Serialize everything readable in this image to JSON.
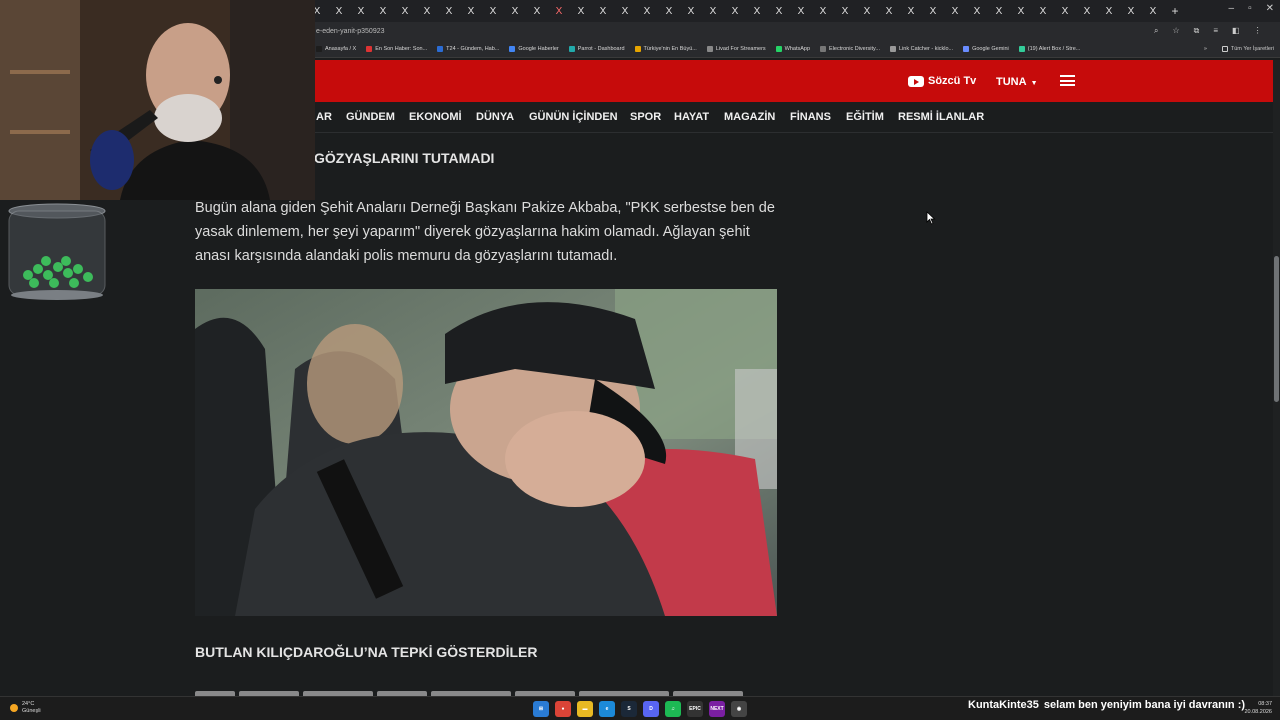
{
  "browser": {
    "tab_close_glyph": "X",
    "new_tab_glyph": "+",
    "window_controls": [
      "–",
      "▫",
      "✕"
    ],
    "url": "e-eden-yanit-p350923",
    "address_icons": [
      "⌕",
      "☆",
      "⧉",
      "≡",
      "◧",
      "⋮"
    ],
    "bookmarks": [
      {
        "label": "Anasayfa / X",
        "color": "#1d1d1d"
      },
      {
        "label": "En Son Haber: Son...",
        "color": "#d33"
      },
      {
        "label": "T24 - Gündem, Hab...",
        "color": "#2b6cd4"
      },
      {
        "label": "Google Haberler",
        "color": "#4285f4"
      },
      {
        "label": "Parrot - Dashboard",
        "color": "#2aa"
      },
      {
        "label": "Türkiye'nin En Büyü...",
        "color": "#e6a400"
      },
      {
        "label": "Livad For Streamers",
        "color": "#888"
      },
      {
        "label": "WhatsApp",
        "color": "#25d366"
      },
      {
        "label": "Electronic Diversity...",
        "color": "#777"
      },
      {
        "label": "Link Catcher - kicklo...",
        "color": "#999"
      },
      {
        "label": "Google Gemini",
        "color": "#6a8cff"
      },
      {
        "label": "(19) Alert Box / Stre...",
        "color": "#3c9"
      }
    ],
    "bookmarks_more": "»",
    "all_bookmarks": "Tüm Yer İşaretleri"
  },
  "site": {
    "youtube_label": "Sözcü Tv",
    "user_label": "TUNA",
    "nav": [
      "AR",
      "GÜNDEM",
      "EKONOMİ",
      "DÜNYA",
      "GÜNÜN İÇİNDEN",
      "SPOR",
      "HAYAT",
      "MAGAZİN",
      "FİNANS",
      "EĞİTİM",
      "RESMİ İLANLAR"
    ]
  },
  "article": {
    "subheading": "GÖZYAŞLARINI TUTAMADI",
    "paragraph": "Bugün alana giden Şehit Analarıı Derneği Başkanı Pakize Akbaba, \"PKK serbestse ben de yasak dinlemem, her şeyi yaparım\" diyerek gözyaşlarına hakim olamadı. Ağlayan şehit anası karşısında alandaki polis memuru da gözyaşlarını tutamadı.",
    "subheading2": "BUTLAN KILIÇDAROĞLU’NA TEPKİ GÖSTERDİLER"
  },
  "taskbar": {
    "temperature": "24°C",
    "weather": "Güneşli",
    "chat_name": "KuntaKinte35",
    "chat_message": "selam ben yeniyim bana iyi davranın :)",
    "time": "08:37",
    "date": "20.08.2026",
    "icons": [
      {
        "name": "windows-start-icon",
        "color": "#2a7bd4",
        "glyph": "⊞"
      },
      {
        "name": "chrome-icon",
        "color": "#db4437",
        "glyph": "●"
      },
      {
        "name": "file-explorer-icon",
        "color": "#e8b923",
        "glyph": "▬"
      },
      {
        "name": "edge-icon",
        "color": "#1c8ad8",
        "glyph": "e"
      },
      {
        "name": "steam-icon",
        "color": "#1b2838",
        "glyph": "S"
      },
      {
        "name": "discord-icon",
        "color": "#5865f2",
        "glyph": "D"
      },
      {
        "name": "spotify-icon",
        "color": "#1db954",
        "glyph": "♫"
      },
      {
        "name": "epic-games-icon",
        "color": "#333",
        "glyph": "EPIC"
      },
      {
        "name": "obs-app-icon",
        "color": "#7a1fa2",
        "glyph": "NEXT"
      },
      {
        "name": "recorder-icon",
        "color": "#444",
        "glyph": "◉"
      }
    ]
  }
}
